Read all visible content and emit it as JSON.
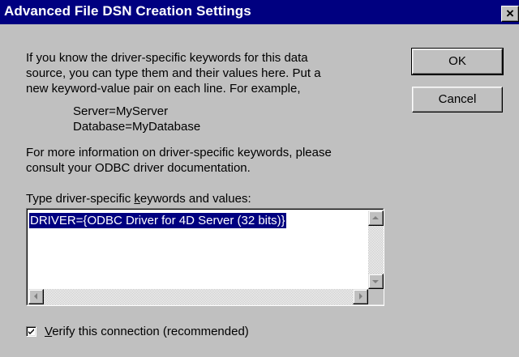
{
  "window": {
    "title": "Advanced File DSN Creation Settings",
    "close_glyph": "×"
  },
  "intro": {
    "line1": "If you know the driver-specific keywords for this data",
    "line2": "source, you can type them and their values here.  Put a",
    "line3": "new keyword-value pair on each line.  For example,"
  },
  "example": {
    "line1": "Server=MyServer",
    "line2": "Database=MyDatabase"
  },
  "info": {
    "line1": "For more information on driver-specific keywords, please",
    "line2": "consult your ODBC driver documentation."
  },
  "keywords": {
    "label_pre": "Type driver-specific ",
    "label_mnemonic": "k",
    "label_post": "eywords and values:",
    "value": "DRIVER={ODBC Driver for 4D Server (32 bits)}"
  },
  "buttons": {
    "ok": "OK",
    "cancel": "Cancel"
  },
  "verify": {
    "checked": true,
    "label_mnemonic": "V",
    "label_post": "erify this connection (recommended)"
  },
  "icons": {
    "close": "close-icon",
    "check": "check-icon",
    "scroll_up": "arrow-up-icon",
    "scroll_down": "arrow-down-icon",
    "scroll_left": "arrow-left-icon",
    "scroll_right": "arrow-right-icon"
  },
  "colors": {
    "title_bar": "#000080",
    "face": "#c0c0c0",
    "selection": "#000080"
  }
}
